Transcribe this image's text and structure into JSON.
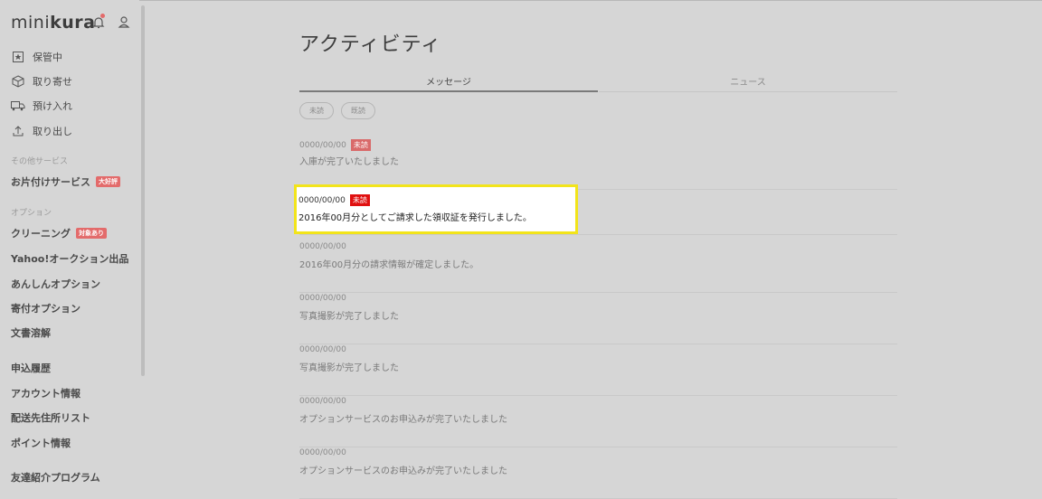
{
  "header": {
    "logo_light": "mini",
    "logo_bold": "kura",
    "icons": {
      "bell": "bell-icon",
      "user": "user-icon"
    },
    "colors": {
      "notification_dot": "#e36b6b"
    }
  },
  "sidebar": {
    "primary_items": [
      {
        "label": "保管中",
        "icon": "star-box-icon"
      },
      {
        "label": "取り寄せ",
        "icon": "box-icon"
      },
      {
        "label": "預け入れ",
        "icon": "truck-icon"
      },
      {
        "label": "取り出し",
        "icon": "upload-icon"
      }
    ],
    "other_services_label": "その他サービス",
    "other_services": [
      {
        "label": "お片付けサービス",
        "badge": "大好評"
      }
    ],
    "options_label": "オプション",
    "options": [
      {
        "label": "クリーニング",
        "badge": "対象あり"
      },
      {
        "label": "Yahoo!オークション出品"
      },
      {
        "label": "あんしんオプション"
      },
      {
        "label": "寄付オプション"
      },
      {
        "label": "文書溶解"
      }
    ],
    "account_links": [
      {
        "label": "申込履歴"
      },
      {
        "label": "アカウント情報"
      },
      {
        "label": "配送先住所リスト"
      },
      {
        "label": "ポイント情報"
      },
      {
        "label": "友達紹介プログラム"
      }
    ]
  },
  "main": {
    "title": "アクティビティ",
    "tabs": [
      {
        "label": "メッセージ",
        "active": true
      },
      {
        "label": "ニュース",
        "active": false
      }
    ],
    "filters": [
      {
        "label": "未読"
      },
      {
        "label": "既読"
      }
    ],
    "unread_badge": "未読",
    "messages": [
      {
        "date": "0000/00/00",
        "unread": true,
        "text": "入庫が完了いたしました"
      },
      {
        "date": "0000/00/00",
        "unread": true,
        "text": "2016年00月分としてご請求した領収証を発行しました。",
        "highlighted": true
      },
      {
        "date": "0000/00/00",
        "unread": false,
        "text": "2016年00月分の請求情報が確定しました。"
      },
      {
        "date": "0000/00/00",
        "unread": false,
        "text": "写真撮影が完了しました"
      },
      {
        "date": "0000/00/00",
        "unread": false,
        "text": "写真撮影が完了しました"
      },
      {
        "date": "0000/00/00",
        "unread": false,
        "text": "オプションサービスのお申込みが完了いたしました"
      },
      {
        "date": "0000/00/00",
        "unread": false,
        "text": "オプションサービスのお申込みが完了いたしました"
      }
    ],
    "colors": {
      "highlight_border": "#f2e41a",
      "unread_badge": "#d96a6a",
      "unread_badge_highlight": "#e01010"
    }
  }
}
